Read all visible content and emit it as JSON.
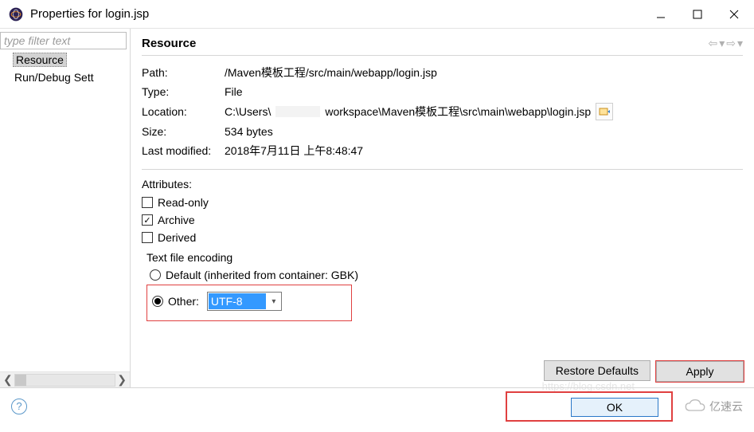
{
  "window": {
    "title": "Properties for login.jsp"
  },
  "sidebar": {
    "filter_placeholder": "type filter text",
    "items": [
      {
        "label": "Resource",
        "selected": true
      },
      {
        "label": "Run/Debug Sett",
        "selected": false
      }
    ]
  },
  "main": {
    "heading": "Resource",
    "props": {
      "path_label": "Path:",
      "path_value": "/Maven模板工程/src/main/webapp/login.jsp",
      "type_label": "Type:",
      "type_value": "File",
      "location_label": "Location:",
      "location_value_prefix": "C:\\Users\\",
      "location_value_suffix": "workspace\\Maven模板工程\\src\\main\\webapp\\login.jsp",
      "size_label": "Size:",
      "size_value": "534  bytes",
      "modified_label": "Last modified:",
      "modified_value": "2018年7月11日 上午8:48:47"
    },
    "attributes": {
      "heading": "Attributes:",
      "readonly_label": "Read-only",
      "readonly_checked": false,
      "archive_label": "Archive",
      "archive_checked": true,
      "derived_label": "Derived",
      "derived_checked": false
    },
    "encoding": {
      "group_label": "Text file encoding",
      "default_label": "Default (inherited from container: GBK)",
      "default_selected": false,
      "other_label": "Other:",
      "other_selected": true,
      "other_value": "UTF-8"
    },
    "buttons": {
      "restore": "Restore Defaults",
      "apply": "Apply",
      "ok": "OK"
    }
  },
  "watermark": "亿速云",
  "faint_url": "https://blog.csdn.net"
}
